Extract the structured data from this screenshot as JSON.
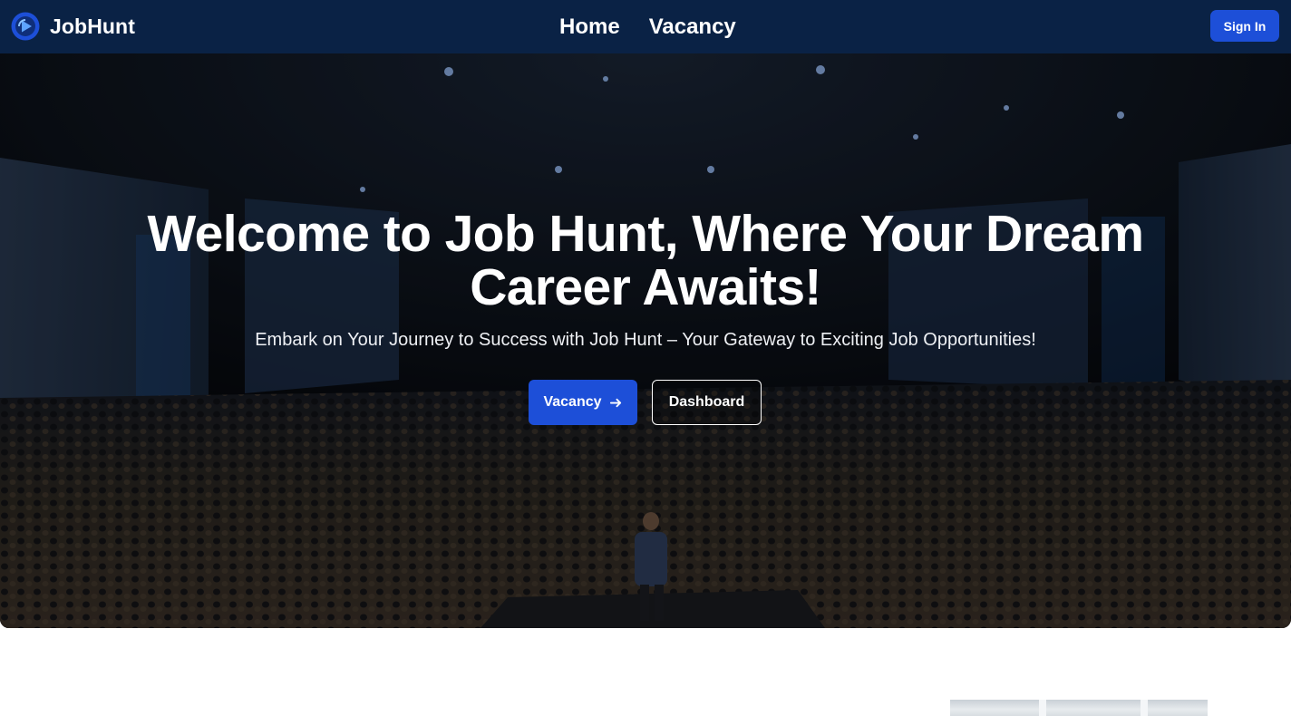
{
  "brand": {
    "name": "JobHunt",
    "logo_icon": "play-circle-logo-icon",
    "color": "#1d4fd8"
  },
  "nav": {
    "links": [
      {
        "label": "Home"
      },
      {
        "label": "Vacancy"
      }
    ],
    "signin_label": "Sign In"
  },
  "hero": {
    "title_line1": "Welcome to Job Hunt, Where Your Dream",
    "title_line2": "Career Awaits!",
    "subtitle": "Embark on Your Journey to Success with Job Hunt – Your Gateway to Exciting Job Opportunities!",
    "primary_button_label": "Vacancy",
    "primary_button_icon": "arrow-right-icon",
    "secondary_button_label": "Dashboard",
    "background_image": "conference-audience-photo"
  },
  "colors": {
    "navbar_bg": "#0a2245",
    "accent": "#1d4fd8",
    "text_light": "#ffffff"
  }
}
